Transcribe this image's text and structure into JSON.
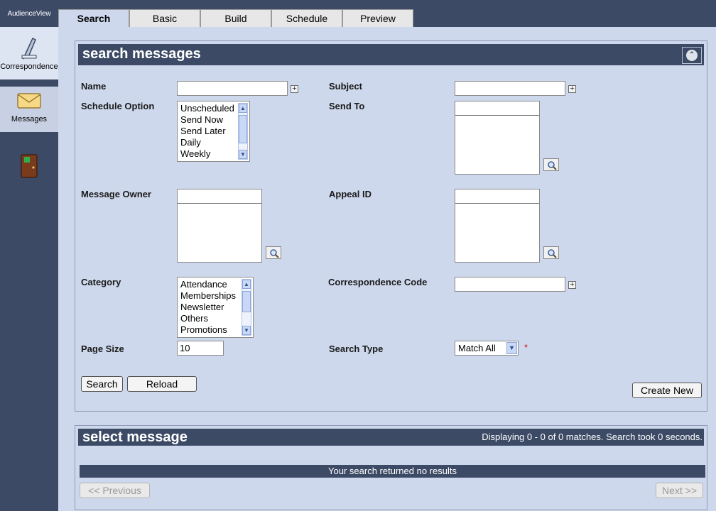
{
  "app": {
    "brand": "AudienceView"
  },
  "nav": {
    "correspondence": "Correspondence",
    "messages": "Messages",
    "exit": ""
  },
  "tabs": [
    {
      "label": "Search"
    },
    {
      "label": "Basic"
    },
    {
      "label": "Build"
    },
    {
      "label": "Schedule"
    },
    {
      "label": "Preview"
    }
  ],
  "search": {
    "title": "search messages",
    "collapse_icon": "⌃",
    "name_label": "Name",
    "name_value": "",
    "subject_label": "Subject",
    "subject_value": "",
    "schedule_label": "Schedule Option",
    "schedule_options": [
      "Unscheduled",
      "Send Now",
      "Send Later",
      "Daily",
      "Weekly"
    ],
    "sendto_label": "Send To",
    "owner_label": "Message Owner",
    "appeal_label": "Appeal ID",
    "category_label": "Category",
    "category_options": [
      "Attendance",
      "Memberships",
      "Newsletter",
      "Others",
      "Promotions"
    ],
    "corr_code_label": "Correspondence Code",
    "corr_code_value": "",
    "page_size_label": "Page Size",
    "page_size_value": "10",
    "search_type_label": "Search Type",
    "search_type_value": "Match All",
    "required_mark": "*",
    "search_button": "Search",
    "reload_button": "Reload",
    "create_button": "Create New"
  },
  "results": {
    "title": "select message",
    "status": "Displaying 0 - 0 of 0 matches. Search took 0 seconds.",
    "empty": "Your search returned no results",
    "prev_button": "<< Previous",
    "next_button": "Next >>"
  }
}
